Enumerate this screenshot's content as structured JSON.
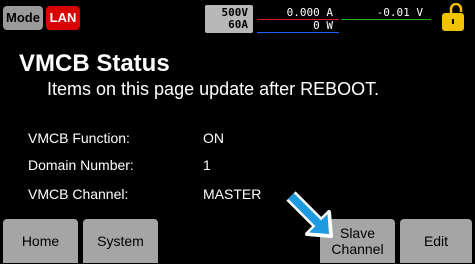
{
  "topbar": {
    "mode_label": "Mode",
    "lan_label": "LAN",
    "rating_voltage": "500V",
    "rating_current": "60A",
    "current_reading": "0.000 A",
    "voltage_reading": "-0.01 V",
    "power_reading": "0 W",
    "lock_icon": "unlocked-padlock-icon"
  },
  "page": {
    "title": "VMCB Status",
    "subtitle": "Items on this page update after REBOOT."
  },
  "info": [
    {
      "label": "VMCB Function:",
      "value": "ON"
    },
    {
      "label": "Domain Number:",
      "value": "1"
    },
    {
      "label": "VMCB Channel:",
      "value": "MASTER"
    }
  ],
  "softkeys": {
    "home": "Home",
    "system": "System",
    "slave_line1": "Slave",
    "slave_line2": "Channel",
    "edit": "Edit"
  },
  "colors": {
    "lan_badge": "#d80000",
    "lock_button": "#f2c200",
    "softkey_bg": "#a5a5a5",
    "pointer_arrow": "#1e9be0"
  }
}
